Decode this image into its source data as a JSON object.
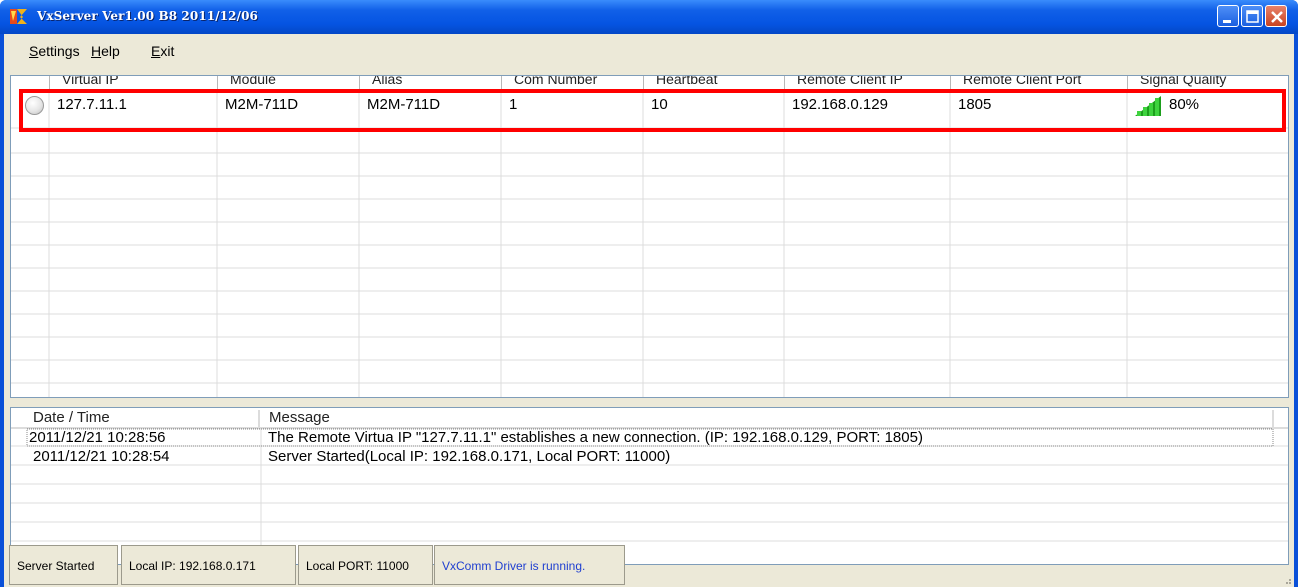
{
  "window": {
    "title": "VxServer Ver1.00 B8 2011/12/06"
  },
  "menu": [
    {
      "label": "Settings"
    },
    {
      "label": "Help"
    },
    {
      "label": "Exit"
    }
  ],
  "grid": {
    "columns": [
      "Virtual IP",
      "Module",
      "Alias",
      "Com Number",
      "Heartbeat",
      "Remote Client IP",
      "Remote Client Port",
      "Signal Quality"
    ],
    "rows": [
      {
        "virtual_ip": "127.7.11.1",
        "module": "M2M-711D",
        "alias": "M2M-711D",
        "com_number": "1",
        "heartbeat": "10",
        "remote_client_ip": "192.168.0.129",
        "remote_client_port": "1805",
        "signal_quality": "80%"
      }
    ]
  },
  "log": {
    "columns": [
      "Date / Time",
      "Message"
    ],
    "rows": [
      {
        "datetime": "2011/12/21   10:28:56",
        "message": "The Remote Virtua IP \"127.7.11.1\" establishes a new connection. (IP: 192.168.0.129, PORT: 1805)"
      },
      {
        "datetime": "2011/12/21   10:28:54",
        "message": "Server Started(Local IP: 192.168.0.171, Local PORT: 11000)"
      }
    ]
  },
  "statusbar": {
    "server_status": "Server Started",
    "local_ip": "Local IP: 192.168.0.171",
    "local_port": "Local PORT: 11000",
    "driver_status": "VxComm Driver is running."
  },
  "colors": {
    "titlebar": "#0554e2",
    "highlight": "#ff0000",
    "driver_status_text": "#1f3fd0",
    "signal_green": "#2fbf2f"
  }
}
